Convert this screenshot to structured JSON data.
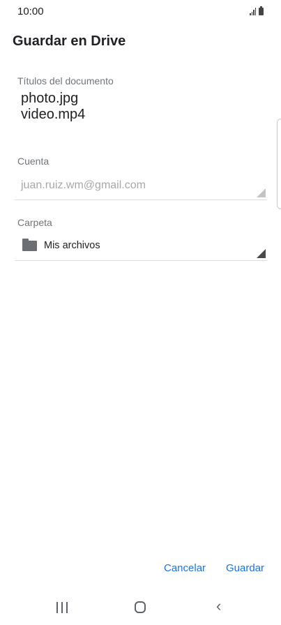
{
  "status_bar": {
    "time": "10:00"
  },
  "header": {
    "title": "Guardar en Drive"
  },
  "form": {
    "doc_titles_label": "Títulos del documento",
    "doc_titles": [
      "photo.jpg",
      "video.mp4"
    ],
    "account_label": "Cuenta",
    "account_value": "juan.ruiz.wm@gmail.com",
    "folder_label": "Carpeta",
    "folder_value": "Mis archivos"
  },
  "actions": {
    "cancel_label": "Cancelar",
    "save_label": "Guardar"
  },
  "icons": {
    "status": [
      "signal-icon",
      "battery-icon"
    ],
    "folder": "folder-icon",
    "nav": [
      "recents-icon",
      "home-icon",
      "back-icon"
    ]
  },
  "colors": {
    "accent": "#1a73e8",
    "text_primary": "#202124",
    "text_secondary": "#70757a",
    "text_disabled": "#a8a8a8"
  }
}
